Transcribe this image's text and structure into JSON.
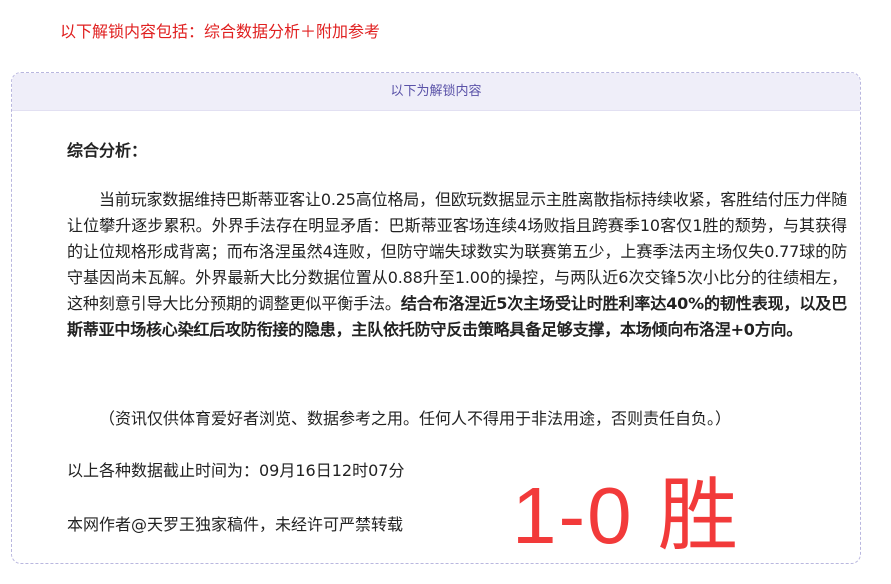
{
  "notice": "以下解锁内容包括：综合数据分析＋附加参考",
  "unlock_box": {
    "header": "以下为解锁内容",
    "heading": "综合分析：",
    "paragraph_plain": "当前玩家数据维持巴斯蒂亚客让0.25高位格局，但欧玩数据显示主胜离散指标持续收紧，客胜结付压力伴随让位攀升逐步累积。外界手法存在明显矛盾：巴斯蒂亚客场连续4场败指且跨赛季10客仅1胜的颓势，与其获得的让位规格形成背离；而布洛涅虽然4连败，但防守端失球数实为联赛第五少，上赛季法丙主场仅失0.77球的防守基因尚未瓦解。外界最新大比分数据位置从0.88升至1.00的操控，与两队近6次交锋5次小比分的往绩相左，这种刻意引导大比分预期的调整更似平衡手法。",
    "paragraph_bold": "结合布洛涅近5次主场受让时胜利率达40%的韧性表现，以及巴斯蒂亚中场核心染红后攻防衔接的隐患，主队依托防守反击策略具备足够支撑，本场倾向布洛涅+0方向。",
    "disclaimer": "（资讯仅供体育爱好者浏览、数据参考之用。任何人不得用于非法用途，否则责任自负。）",
    "cutoff_time": "以上各种数据截止时间为：09月16日12时07分",
    "copyright": "本网作者@天罗王独家稿件，未经许可严禁转载"
  },
  "result_stamp": "1-0 胜",
  "colors": {
    "notice_red": "#e02020",
    "stamp_red": "#f23a3a",
    "header_bg": "#efeef9",
    "header_text": "#5a52a8",
    "border": "#b9b7df"
  }
}
